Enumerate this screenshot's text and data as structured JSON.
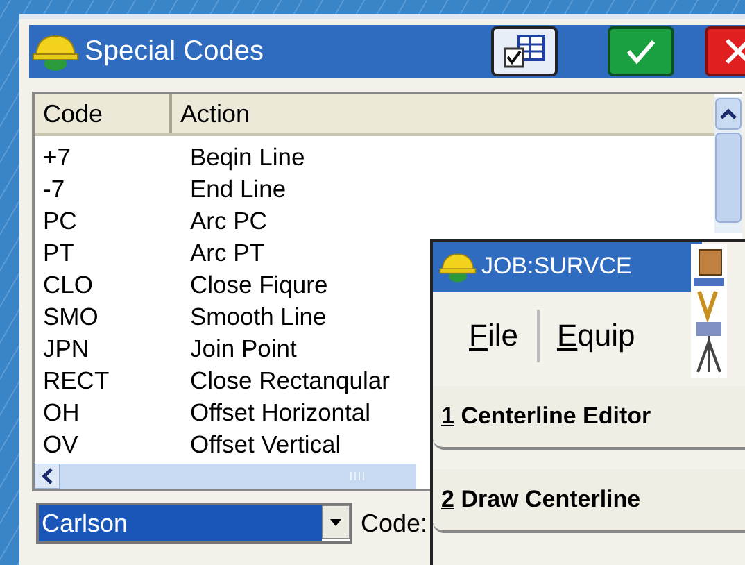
{
  "window": {
    "title": "Special Codes"
  },
  "table": {
    "columns": [
      "Code",
      "Action"
    ],
    "rows": [
      [
        "+7",
        "Beqin Line"
      ],
      [
        "-7",
        "End Line"
      ],
      [
        "PC",
        "Arc PC"
      ],
      [
        "PT",
        "Arc PT"
      ],
      [
        "CLO",
        "Close Fiqure"
      ],
      [
        "SMO",
        "Smooth Line"
      ],
      [
        "JPN",
        "Join Point"
      ],
      [
        "RECT",
        "Close Rectanqular"
      ],
      [
        "OH",
        "Offset Horizontal"
      ],
      [
        "OV",
        "Offset Vertical"
      ]
    ]
  },
  "library_select": {
    "value": "Carlson",
    "selected": true
  },
  "code_label": "Code:",
  "job_window": {
    "title": "JOB:SURVCE",
    "menus": [
      {
        "label": "File",
        "mnemonic": true
      },
      {
        "label": "Equip",
        "mnemonic": true
      }
    ],
    "buttons": [
      {
        "label": "1 Centerline Editor",
        "mnemonic": true
      },
      {
        "label": "2 Draw Centerline",
        "mnemonic": true
      }
    ]
  }
}
